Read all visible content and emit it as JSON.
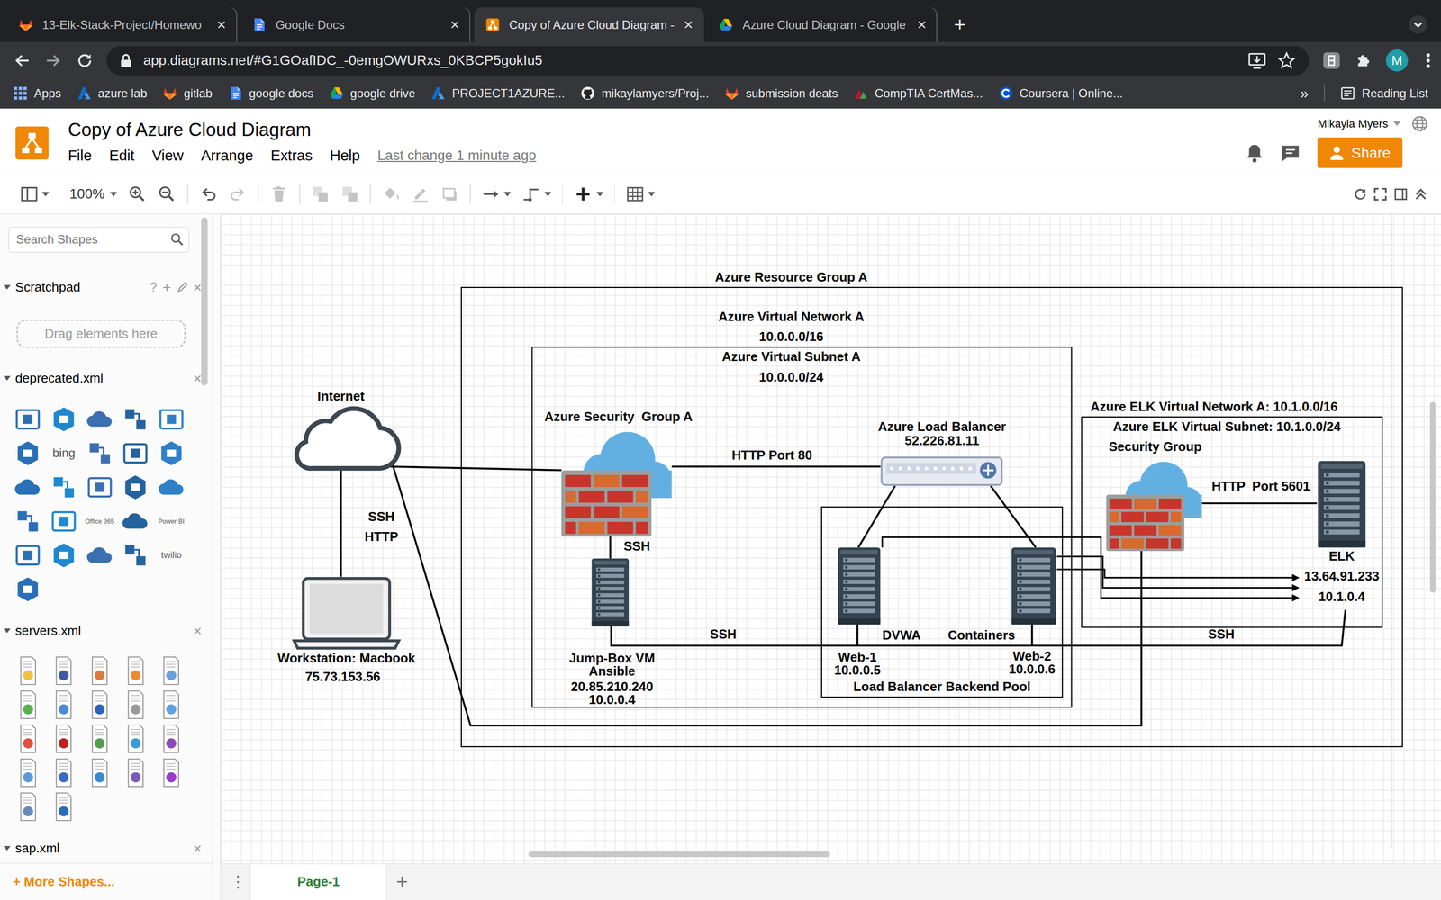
{
  "browser": {
    "tabs": [
      {
        "label": "13-Elk-Stack-Project/Homewo",
        "close": "×",
        "selected": false
      },
      {
        "label": "Google Docs",
        "close": "×",
        "selected": false
      },
      {
        "label": "Copy of Azure Cloud Diagram -",
        "close": "×",
        "selected": true
      },
      {
        "label": "Azure Cloud Diagram - Google",
        "close": "×",
        "selected": false
      }
    ],
    "new_tab": "+",
    "url": "app.diagrams.net/#G1GOafIDC_-0emgOWURxs_0KBCP5gokIu5",
    "profile_initial": "M",
    "bookmarks": [
      "Apps",
      "azure lab",
      "gitlab",
      "google docs",
      "google drive",
      "PROJECT1AZURE...",
      "mikaylamyers/Proj...",
      "submission deats",
      "CompTIA CertMas...",
      "Coursera | Online..."
    ],
    "bookmarks_more": "»",
    "reading_list": "Reading List"
  },
  "app": {
    "title": "Copy of Azure Cloud Diagram",
    "menus": [
      "File",
      "Edit",
      "View",
      "Arrange",
      "Extras",
      "Help"
    ],
    "last_change": "Last change 1 minute ago",
    "user": "Mikayla Myers",
    "share": "Share"
  },
  "toolbar": {
    "zoom": "100%",
    "tools": [
      {
        "disabled": false
      },
      {
        "disabled": false
      },
      {
        "disabled": false
      },
      {
        "disabled": false
      },
      {
        "disabled": true
      },
      {
        "disabled": true
      },
      {
        "disabled": true
      },
      {
        "disabled": true
      },
      {
        "disabled": true
      },
      {
        "disabled": true
      },
      {
        "disabled": true
      },
      {
        "disabled": false
      },
      {
        "disabled": false
      },
      {
        "disabled": false
      },
      {
        "disabled": false
      }
    ]
  },
  "sidebar": {
    "search_placeholder": "Search Shapes",
    "scratchpad": {
      "title": "Scratchpad",
      "expanded": true,
      "help": "?",
      "add": "+",
      "close": "×",
      "drop_hint": "Drag elements here"
    },
    "libraries": [
      {
        "title": "deprecated.xml",
        "expanded": true,
        "close": "×",
        "shapes": [
          {
            "kind": "icon"
          },
          {
            "kind": "icon"
          },
          {
            "kind": "icon"
          },
          {
            "kind": "icon"
          },
          {
            "kind": "icon"
          },
          {
            "kind": "icon"
          },
          {
            "kind": "text",
            "label": "bing"
          },
          {
            "kind": "icon"
          },
          {
            "kind": "icon"
          },
          {
            "kind": "icon"
          },
          {
            "kind": "icon"
          },
          {
            "kind": "icon"
          },
          {
            "kind": "icon"
          },
          {
            "kind": "icon"
          },
          {
            "kind": "icon"
          },
          {
            "kind": "icon"
          },
          {
            "kind": "icon"
          },
          {
            "kind": "text",
            "label": "Office 365"
          },
          {
            "kind": "icon"
          },
          {
            "kind": "text",
            "label": "Power BI"
          },
          {
            "kind": "icon"
          },
          {
            "kind": "icon"
          },
          {
            "kind": "icon"
          },
          {
            "kind": "icon"
          },
          {
            "kind": "text",
            "label": "twilio"
          },
          {
            "kind": "icon"
          }
        ]
      },
      {
        "title": "servers.xml",
        "expanded": true,
        "close": "×"
      },
      {
        "title": "sap.xml",
        "expanded": true,
        "close": "×"
      }
    ],
    "more_shapes": "+ More Shapes..."
  },
  "diagram": {
    "containers": [
      {
        "lines": [
          "Azure Resource Group A"
        ]
      },
      {
        "lines": [
          "Azure Virtual Network A",
          "10.0.0.0/16"
        ]
      },
      {
        "lines": [
          "Azure Virtual Subnet A",
          "10.0.0.0/24"
        ]
      },
      {
        "lines": [
          "Load Balancer Backend Pool"
        ]
      },
      {
        "lines": [
          "Azure ELK Virtual Network A: 10.1.0.0/16",
          "Azure ELK Virtual Subnet: 10.1.0.0/24"
        ]
      }
    ],
    "nodes": [
      {
        "kind": "cloud",
        "lines": [
          "Internet"
        ]
      },
      {
        "kind": "laptop",
        "lines": [
          "Workstation: Macbook",
          "75.73.153.56"
        ]
      },
      {
        "kind": "firewall",
        "lines": [
          "Azure Security  Group A"
        ]
      },
      {
        "kind": "server",
        "lines": [
          "Jump-Box VM",
          "Ansible",
          "20.85.210.240",
          "10.0.0.4"
        ]
      },
      {
        "kind": "balancer",
        "lines": [
          "Azure Load Balancer",
          "52.226.81.11"
        ]
      },
      {
        "kind": "server",
        "lines": [
          "Web-1",
          "10.0.0.5"
        ]
      },
      {
        "kind": "server",
        "lines": [
          "Web-2",
          "10.0.0.6"
        ]
      },
      {
        "kind": "firewall",
        "lines": [
          "Security Group"
        ]
      },
      {
        "kind": "server",
        "lines": [
          "ELK",
          "13.64.91.233",
          "10.1.0.4"
        ]
      }
    ],
    "edge_labels": [
      "HTTP Port 80",
      "HTTP  Port 5601",
      "SSH",
      "HTTP",
      "SSH",
      "SSH",
      "DVWA",
      "Containers",
      "SSH"
    ]
  },
  "pages": {
    "menu": "⋮",
    "tabs": [
      {
        "label": "Page-1",
        "selected": true
      }
    ],
    "add": "+"
  }
}
